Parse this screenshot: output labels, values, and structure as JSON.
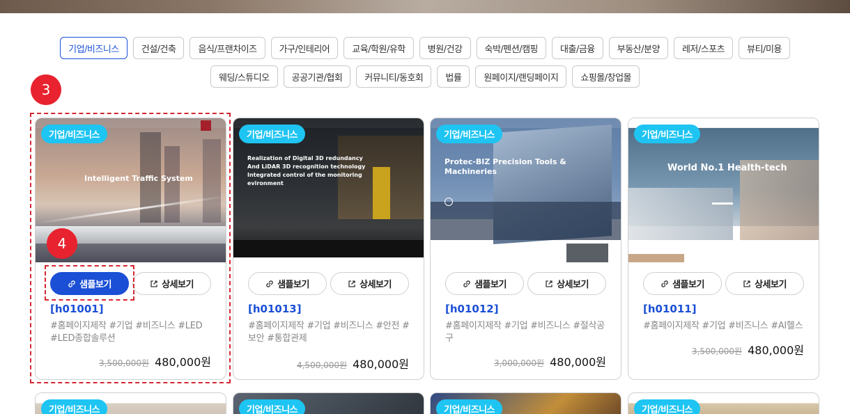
{
  "categories_row1": [
    "기업/비즈니스",
    "건설/건축",
    "음식/프랜차이즈",
    "가구/인테리어",
    "교육/학원/유학",
    "병원/건강",
    "숙박/펜션/캠핑",
    "대출/금융",
    "부동산/분양",
    "레저/스포츠",
    "뷰티/미용"
  ],
  "categories_row2": [
    "웨딩/스튜디오",
    "공공기관/협회",
    "커뮤니티/동호회",
    "법률",
    "원페이지/랜딩페이지",
    "쇼핑몰/창업몰"
  ],
  "active_category": "기업/비즈니스",
  "markers": {
    "card": "3",
    "button": "4"
  },
  "buttons": {
    "sample": "샘플보기",
    "detail": "상세보기"
  },
  "products": [
    {
      "badge": "기업/비즈니스",
      "code": "[h01001]",
      "tags": "#홈페이지제작 #기업 #비즈니스 #LED #LED종합솔루션",
      "old_price": "3,500,000원",
      "price": "480,000원",
      "hero": "Intelligent Traffic System"
    },
    {
      "badge": "기업/비즈니스",
      "code": "[h01013]",
      "tags": "#홈페이지제작 #기업 #비즈니스 #안전 #보안 #통합관제",
      "old_price": "4,500,000원",
      "price": "480,000원",
      "hero": "Realization of Digital 3D redundancy And LiDAR 3D recognition technology Integrated control of the monitoring evironment"
    },
    {
      "badge": "기업/비즈니스",
      "code": "[h01012]",
      "tags": "#홈페이지제작 #기업 #비즈니스 #절삭공구",
      "old_price": "3,000,000원",
      "price": "480,000원",
      "hero": "Protec-BIZ Precision Tools & Machineries"
    },
    {
      "badge": "기업/비즈니스",
      "code": "[h01011]",
      "tags": "#홈페이지제작 #기업 #비즈니스 #AI헬스",
      "old_price": "3,500,000원",
      "price": "480,000원",
      "hero": "World No.1 Health-tech"
    }
  ],
  "peek_badges": [
    "기업/비즈니스",
    "기업/비즈니스",
    "기업/비즈니스",
    "기업/비즈니스"
  ],
  "colors": {
    "accent": "#1a4fd6",
    "badge": "#1ec4f2",
    "marker": "#e8222e"
  }
}
